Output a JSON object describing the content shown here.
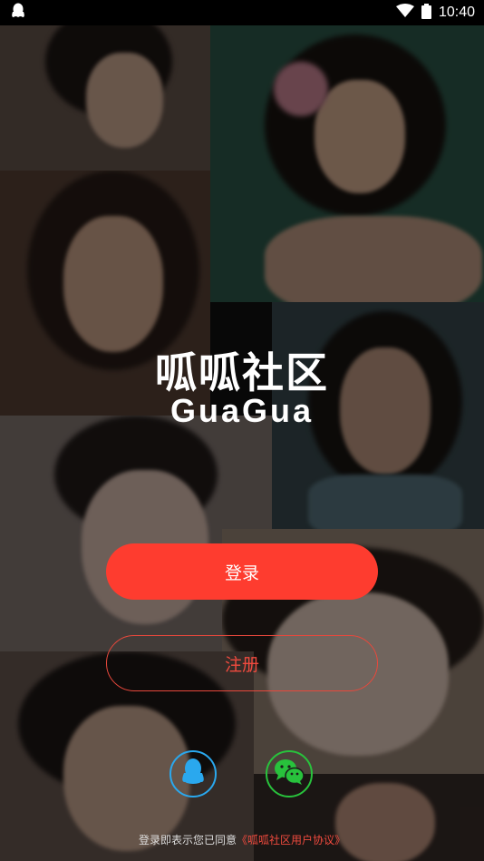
{
  "status_bar": {
    "time": "10:40",
    "icons": [
      "qq-notification-icon",
      "wifi-icon",
      "battery-icon"
    ]
  },
  "logo": {
    "chinese": "呱呱社区",
    "english": "GuaGua"
  },
  "buttons": {
    "login": "登录",
    "register": "注册"
  },
  "social_login": {
    "qq": "qq-icon",
    "wechat": "wechat-icon"
  },
  "agreement": {
    "prefix": "登录即表示您已同意",
    "link": "《呱呱社区用户协议》"
  },
  "colors": {
    "primary": "#fe3c2f",
    "qq": "#2aa8ee",
    "wechat": "#28c23c"
  }
}
